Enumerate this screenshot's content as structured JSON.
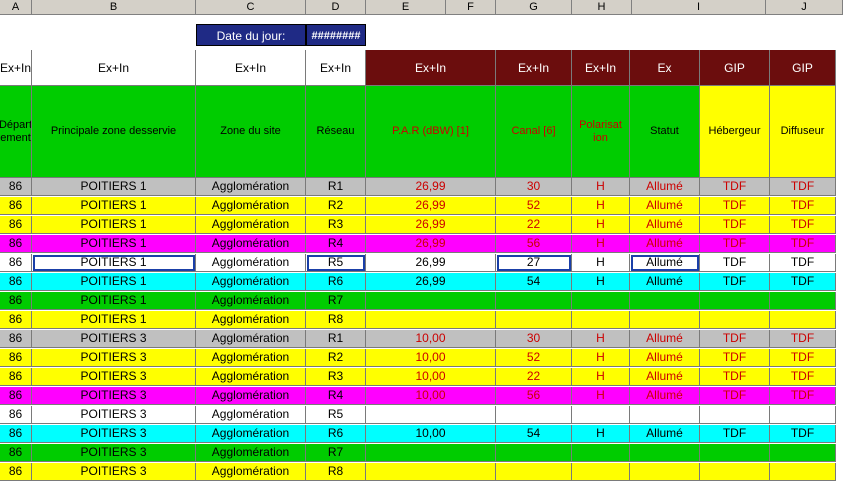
{
  "column_letters": [
    "A",
    "B",
    "C",
    "D",
    "E",
    "F",
    "G",
    "H",
    "I",
    "J"
  ],
  "header": {
    "date_label": "Date du jour:",
    "date_value": "########"
  },
  "header_row1": [
    "Ex+In",
    "Ex+In",
    "Ex+In",
    "Ex+In",
    "Ex+In",
    "Ex+In",
    "Ex+In",
    "Ex",
    "GIP",
    "GIP"
  ],
  "header_row2": [
    "Départ ement",
    "Principale zone desservie",
    "Zone du site",
    "Réseau",
    "P.A.R (dBW) [1]",
    "Canal [6]",
    "Polarisat ion",
    "Statut",
    "Hébergeur",
    "Diffuseur"
  ],
  "colors": {
    "dark_red": "#6b0d0d",
    "green": "#00cc00",
    "yellow": "#ffff00",
    "grey": "#c0c0c0",
    "magenta": "#ff00ff",
    "cyan": "#00ffff",
    "white": "#ffffff",
    "red_text": "#cc0000"
  },
  "rows": [
    {
      "color": "grey",
      "values": [
        "86",
        "POITIERS 1",
        "Agglomération",
        "R1",
        "26,99",
        "30",
        "H",
        "Allumé",
        "TDF",
        "TDF"
      ]
    },
    {
      "color": "yellow",
      "values": [
        "86",
        "POITIERS 1",
        "Agglomération",
        "R2",
        "26,99",
        "52",
        "H",
        "Allumé",
        "TDF",
        "TDF"
      ]
    },
    {
      "color": "yellow",
      "values": [
        "86",
        "POITIERS 1",
        "Agglomération",
        "R3",
        "26,99",
        "22",
        "H",
        "Allumé",
        "TDF",
        "TDF"
      ]
    },
    {
      "color": "magenta",
      "values": [
        "86",
        "POITIERS 1",
        "Agglomération",
        "R4",
        "26,99",
        "56",
        "H",
        "Allumé",
        "TDF",
        "TDF"
      ]
    },
    {
      "color": "white",
      "values": [
        "86",
        "POITIERS 1",
        "Agglomération",
        "R5",
        "26,99",
        "27",
        "H",
        "Allumé",
        "TDF",
        "TDF"
      ]
    },
    {
      "color": "cyan",
      "values": [
        "86",
        "POITIERS 1",
        "Agglomération",
        "R6",
        "26,99",
        "54",
        "H",
        "Allumé",
        "TDF",
        "TDF"
      ]
    },
    {
      "color": "green",
      "values": [
        "86",
        "POITIERS 1",
        "Agglomération",
        "R7",
        "",
        "",
        "",
        "",
        "",
        ""
      ]
    },
    {
      "color": "yellow",
      "values": [
        "86",
        "POITIERS 1",
        "Agglomération",
        "R8",
        "",
        "",
        "",
        "",
        "",
        ""
      ]
    },
    {
      "color": "grey",
      "values": [
        "86",
        "POITIERS 3",
        "Agglomération",
        "R1",
        "10,00",
        "30",
        "H",
        "Allumé",
        "TDF",
        "TDF"
      ]
    },
    {
      "color": "yellow",
      "values": [
        "86",
        "POITIERS 3",
        "Agglomération",
        "R2",
        "10,00",
        "52",
        "H",
        "Allumé",
        "TDF",
        "TDF"
      ]
    },
    {
      "color": "yellow",
      "values": [
        "86",
        "POITIERS 3",
        "Agglomération",
        "R3",
        "10,00",
        "22",
        "H",
        "Allumé",
        "TDF",
        "TDF"
      ]
    },
    {
      "color": "magenta",
      "values": [
        "86",
        "POITIERS 3",
        "Agglomération",
        "R4",
        "10,00",
        "56",
        "H",
        "Allumé",
        "TDF",
        "TDF"
      ]
    },
    {
      "color": "white",
      "values": [
        "86",
        "POITIERS 3",
        "Agglomération",
        "R5",
        "",
        "",
        "",
        "",
        "",
        ""
      ]
    },
    {
      "color": "cyan",
      "values": [
        "86",
        "POITIERS 3",
        "Agglomération",
        "R6",
        "10,00",
        "54",
        "H",
        "Allumé",
        "TDF",
        "TDF"
      ]
    },
    {
      "color": "green",
      "values": [
        "86",
        "POITIERS 3",
        "Agglomération",
        "R7",
        "",
        "",
        "",
        "",
        "",
        ""
      ]
    },
    {
      "color": "yellow",
      "values": [
        "86",
        "POITIERS 3",
        "Agglomération",
        "R8",
        "",
        "",
        "",
        "",
        "",
        ""
      ]
    }
  ]
}
